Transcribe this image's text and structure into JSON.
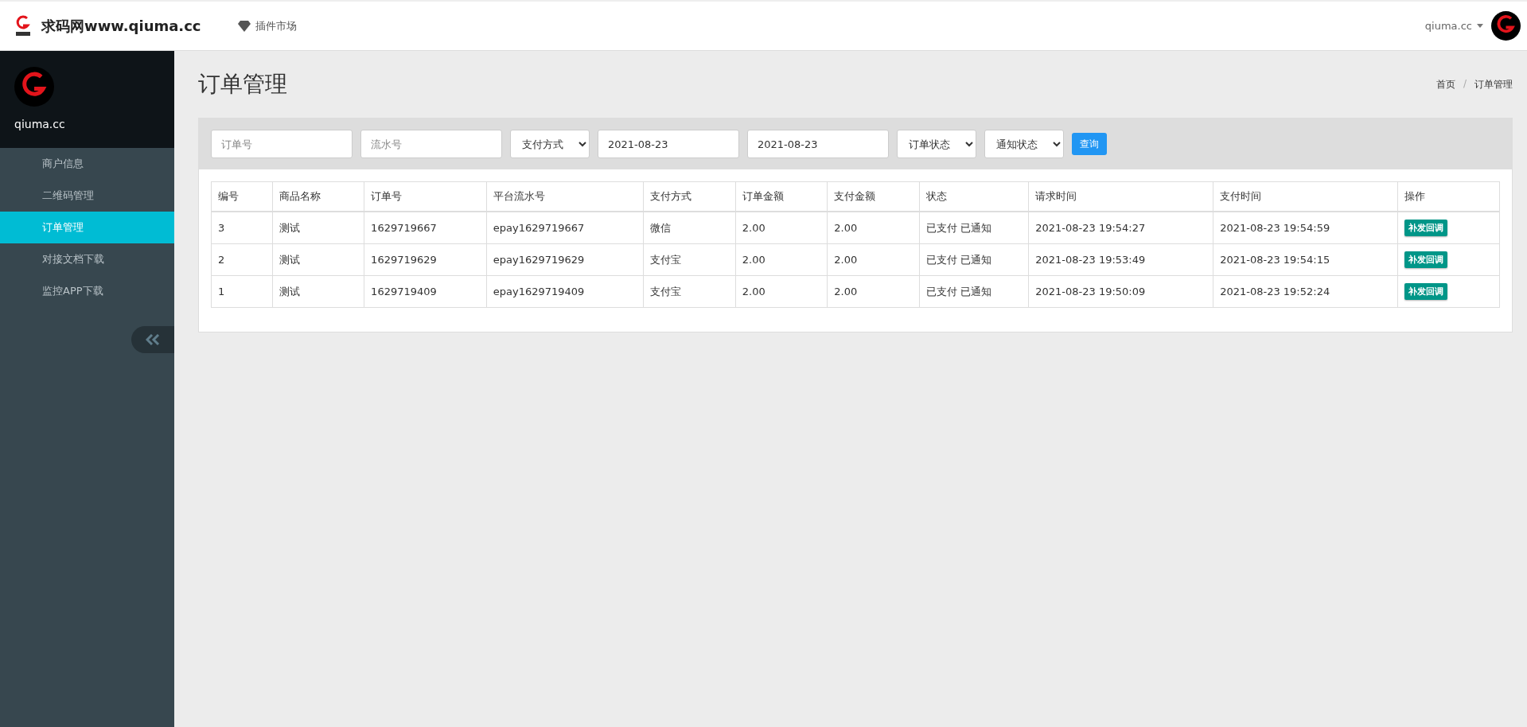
{
  "topbar": {
    "brand": "求码网www.qiuma.cc",
    "nav": [
      {
        "label": "插件市场"
      }
    ],
    "user": "qiuma.cc"
  },
  "sidebar": {
    "username": "qiuma.cc",
    "items": [
      {
        "label": "商户信息",
        "selected": false
      },
      {
        "label": "二维码管理",
        "selected": false
      },
      {
        "label": "订单管理",
        "selected": true
      },
      {
        "label": "对接文档下载",
        "selected": false
      },
      {
        "label": "监控APP下载",
        "selected": false
      }
    ]
  },
  "page": {
    "title": "订单管理",
    "breadcrumb": [
      "首页",
      "订单管理"
    ],
    "breadcrumb_separator": "/"
  },
  "filters": [
    {
      "kind": "text",
      "placeholder": "订单号"
    },
    {
      "kind": "text",
      "placeholder": "流水号"
    },
    {
      "kind": "select",
      "value": "支付方式"
    },
    {
      "kind": "text",
      "value": "2021-08-23"
    },
    {
      "kind": "text",
      "value": "2021-08-23"
    },
    {
      "kind": "select",
      "value": "订单状态"
    },
    {
      "kind": "select",
      "value": "通知状态"
    },
    {
      "kind": "button",
      "label": "查询"
    }
  ],
  "table": {
    "columns": [
      "编号",
      "商品名称",
      "订单号",
      "平台流水号",
      "支付方式",
      "订单金额",
      "支付金额",
      "状态",
      "请求时间",
      "支付时间",
      "操作"
    ],
    "rows": [
      {
        "cells": [
          "3",
          "测试",
          "1629719667",
          "epay1629719667",
          "微信",
          "2.00",
          "2.00",
          "已支付 已通知",
          "2021-08-23 19:54:27",
          "2021-08-23 19:54:59"
        ],
        "action": "补发回调"
      },
      {
        "cells": [
          "2",
          "测试",
          "1629719629",
          "epay1629719629",
          "支付宝",
          "2.00",
          "2.00",
          "已支付 已通知",
          "2021-08-23 19:53:49",
          "2021-08-23 19:54:15"
        ],
        "action": "补发回调"
      },
      {
        "cells": [
          "1",
          "测试",
          "1629719409",
          "epay1629719409",
          "支付宝",
          "2.00",
          "2.00",
          "已支付 已通知",
          "2021-08-23 19:50:09",
          "2021-08-23 19:52:24"
        ],
        "action": "补发回调"
      }
    ]
  }
}
